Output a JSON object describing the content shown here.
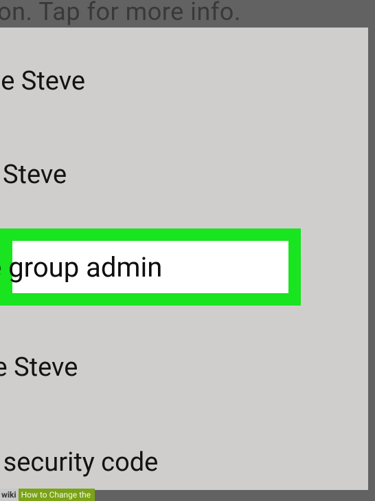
{
  "dimmed_text": "cryption. Tap for more info.",
  "menu": {
    "items": [
      "ssage Steve",
      "w Steve",
      "te group admin",
      "nove Steve",
      "fy security code"
    ],
    "highlighted_index": 2
  },
  "watermark": {
    "brand_prefix": "wiki",
    "brand_suffix": "How to Change the"
  }
}
